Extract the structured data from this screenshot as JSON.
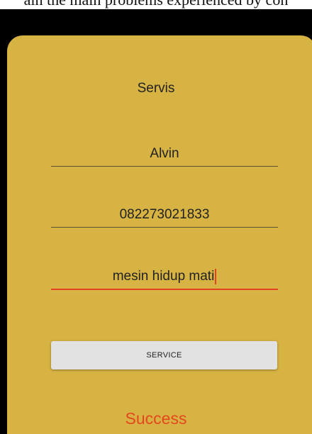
{
  "caption": "ain the main problems experienced by con",
  "app": {
    "title": "Servis",
    "fields": [
      {
        "value": "Alvin"
      },
      {
        "value": "082273021833"
      },
      {
        "value": "mesin hidup mati"
      }
    ],
    "button_label": "SERVICE",
    "status": "Success"
  },
  "colors": {
    "panel_background": "#d7b343",
    "accent": "#e0431f",
    "button_background": "#e2e2e2",
    "status_text": "#e5471d"
  }
}
